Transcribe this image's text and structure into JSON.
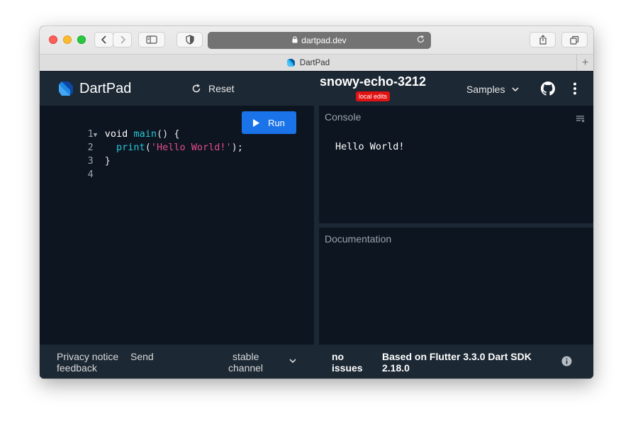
{
  "browser": {
    "address": "dartpad.dev",
    "tab_title": "DartPad",
    "new_tab": "+"
  },
  "app": {
    "brand": "DartPad",
    "reset_label": "Reset",
    "project_name": "snowy-echo-3212",
    "badge": "local edits",
    "samples_label": "Samples"
  },
  "editor": {
    "run_label": "Run",
    "line_numbers": [
      "1",
      "2",
      "3",
      "4"
    ],
    "code": {
      "l1_kw": "void",
      "l1_fn": "main",
      "l1_rest": "() {",
      "l2_fn": "print",
      "l2_open": "(",
      "l2_str": "'Hello World!'",
      "l2_close": ");",
      "l3": "}"
    }
  },
  "console": {
    "title": "Console",
    "output": "Hello World!"
  },
  "documentation": {
    "title": "Documentation"
  },
  "footer": {
    "privacy_notice": "Privacy notice",
    "send_feedback_1": "Send",
    "send_feedback_2": "feedback",
    "channel_1": "stable",
    "channel_2": "channel",
    "issues_1": "no",
    "issues_2": "issues",
    "version_1": "Based on Flutter 3.3.0 Dart SDK",
    "version_2": "2.18.0"
  },
  "colors": {
    "app_bar": "#1c2834",
    "editor_bg": "#0d1520",
    "run_button": "#1a73e8",
    "badge": "#e21212",
    "brand_blue": "#1e88e5"
  },
  "icons": [
    "back-icon",
    "forward-icon",
    "sidebar-icon",
    "shield-icon",
    "lock-icon",
    "reload-icon",
    "share-icon",
    "tabs-icon",
    "dart-logo-icon",
    "reset-icon",
    "chevron-down-icon",
    "github-icon",
    "more-vert-icon",
    "play-icon",
    "clear-console-icon",
    "info-icon"
  ]
}
